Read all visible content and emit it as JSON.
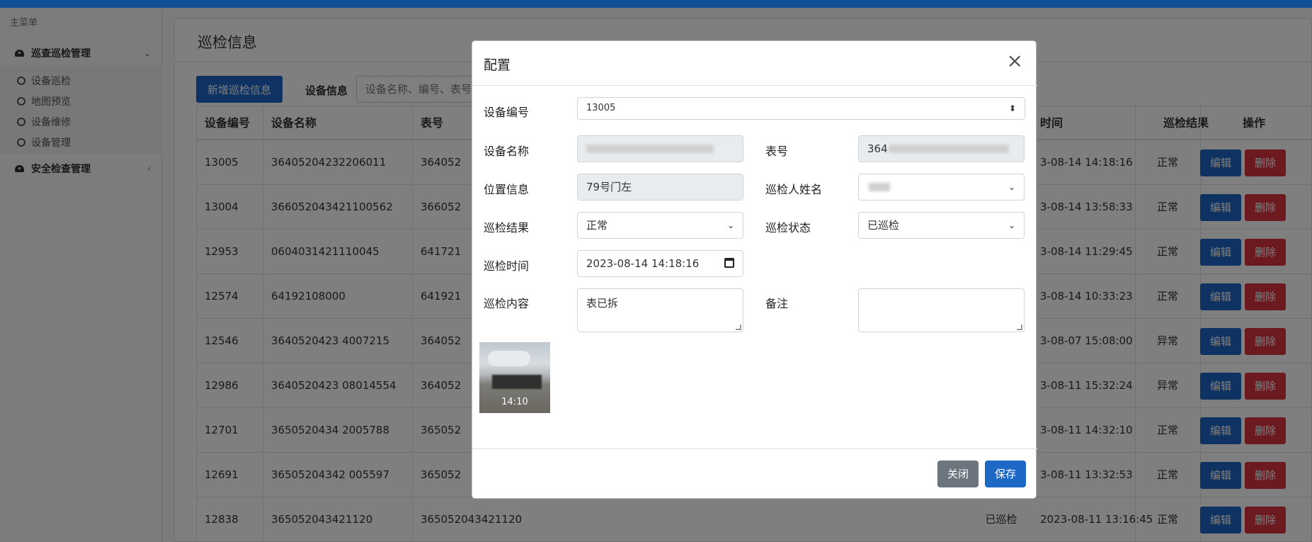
{
  "sidebar": {
    "heading": "主菜单",
    "groups": [
      {
        "label": "巡查巡检管理",
        "chevron": "⌄",
        "items": [
          "设备巡检",
          "地图预览",
          "设备维修",
          "设备管理"
        ]
      },
      {
        "label": "安全检查管理",
        "chevron": "‹"
      }
    ]
  },
  "page": {
    "title": "巡检信息",
    "add_button": "新增巡检信息",
    "filter_label": "设备信息",
    "filter_placeholder": "设备名称、编号、表号"
  },
  "table": {
    "columns": [
      "设备编号",
      "设备名称",
      "表号",
      "时间",
      "巡检结果",
      "操作"
    ],
    "edit_label": "编辑",
    "delete_label": "删除",
    "rows": [
      {
        "id": "13005",
        "name": "36405204232206011",
        "meter": "364052",
        "status": "",
        "time": "3-08-14 14:18:16",
        "result": "正常"
      },
      {
        "id": "13004",
        "name": "366052043421100562",
        "meter": "366052",
        "status": "",
        "time": "3-08-14 13:58:33",
        "result": "正常"
      },
      {
        "id": "12953",
        "name": "0604031421110045",
        "meter": "641721",
        "status": "",
        "time": "3-08-14 11:29:45",
        "result": "正常"
      },
      {
        "id": "12574",
        "name": "64192108000",
        "meter": "641921",
        "status": "",
        "time": "3-08-14 10:33:23",
        "result": "正常"
      },
      {
        "id": "12546",
        "name": "3640520423 4007215",
        "meter": "364052",
        "status": "",
        "time": "3-08-07 15:08:00",
        "result": "异常"
      },
      {
        "id": "12986",
        "name": "3640520423 08014554",
        "meter": "364052",
        "status": "",
        "time": "3-08-11 15:32:24",
        "result": "异常"
      },
      {
        "id": "12701",
        "name": "3650520434 2005788",
        "meter": "365052",
        "status": "",
        "time": "3-08-11 14:32:10",
        "result": "正常"
      },
      {
        "id": "12691",
        "name": "36505204342 005597",
        "meter": "365052",
        "status": "",
        "time": "3-08-11 13:32:53",
        "result": "正常"
      },
      {
        "id": "12838",
        "name": "365052043421120",
        "meter": "365052043421120",
        "status": "已巡检",
        "time": "2023-08-11 13:16:45",
        "result": "正常"
      }
    ]
  },
  "modal": {
    "title": "配置",
    "close_icon": "×",
    "fields": {
      "device_id": {
        "label": "设备编号",
        "value": "13005"
      },
      "device_name": {
        "label": "设备名称",
        "value": ""
      },
      "meter_no": {
        "label": "表号",
        "value": "364"
      },
      "location": {
        "label": "位置信息",
        "value": "79号门左"
      },
      "inspector": {
        "label": "巡检人姓名",
        "value": ""
      },
      "result": {
        "label": "巡检结果",
        "value": "正常"
      },
      "status": {
        "label": "巡检状态",
        "value": "已巡检"
      },
      "time": {
        "label": "巡检时间",
        "value": "2023-08-14 14:18:16"
      },
      "content": {
        "label": "巡检内容",
        "value": "表已拆"
      },
      "remark": {
        "label": "备注",
        "value": ""
      }
    },
    "photo_time": "14:10",
    "close_button": "关闭",
    "save_button": "保存"
  },
  "colors": {
    "topbar": "#0e4f95",
    "primary": "#1d67c5",
    "danger": "#d9333f",
    "secondary": "#6c757d"
  }
}
